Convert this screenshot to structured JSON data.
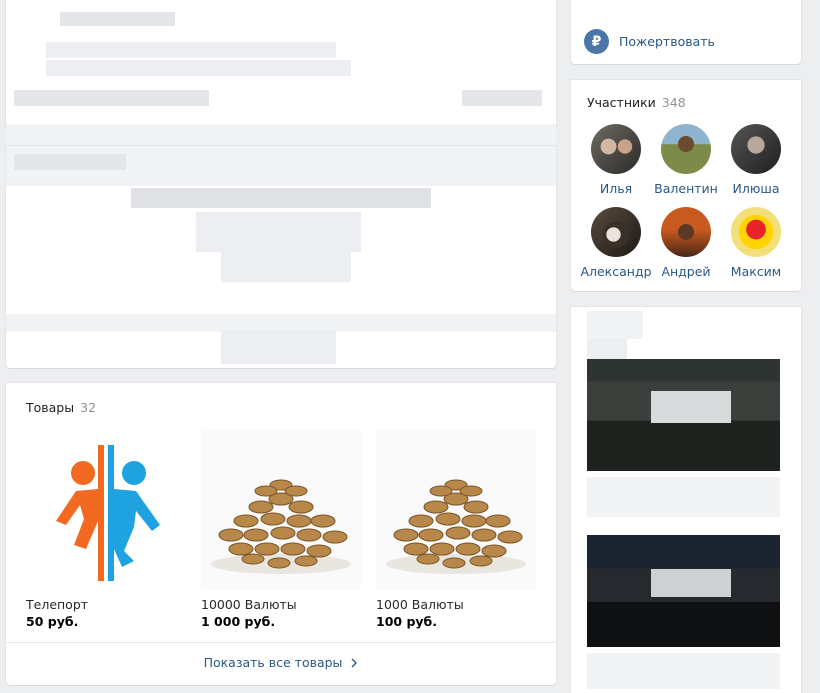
{
  "sidebar": {
    "donate_label": "Пожертвовать",
    "donate_icon_glyph": "₽",
    "members": {
      "title": "Участники",
      "count": "348",
      "items": [
        {
          "name": "Илья"
        },
        {
          "name": "Валентин"
        },
        {
          "name": "Илюша"
        },
        {
          "name": "Александр"
        },
        {
          "name": "Андрей"
        },
        {
          "name": "Максим"
        }
      ]
    }
  },
  "goods": {
    "title": "Товары",
    "count": "32",
    "items": [
      {
        "name": "Телепорт",
        "price": "50 руб."
      },
      {
        "name": "10000 Валюты",
        "price": "1 000 руб."
      },
      {
        "name": "1000 Валюты",
        "price": "100 руб."
      }
    ],
    "show_all_label": "Показать все товары",
    "show_all_icon": "chevron-right-icon"
  },
  "colors": {
    "link": "#2a5885",
    "accent": "#4a76a8",
    "background": "#edeef0",
    "portal_orange": "#f26a21",
    "portal_blue": "#1fa3e0"
  }
}
